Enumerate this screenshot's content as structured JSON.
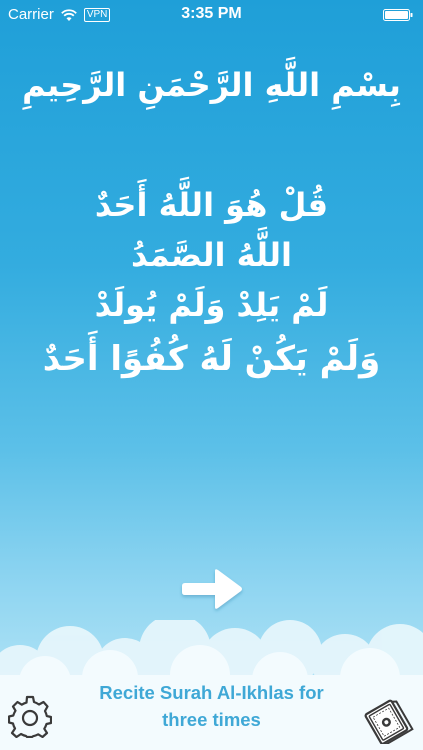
{
  "status_bar": {
    "carrier": "Carrier",
    "vpn": "VPN",
    "time": "3:35 PM"
  },
  "bismillah": "بِسْمِ اللَّهِ الرَّحْمَنِ الرَّحِيمِ",
  "surah": {
    "ayat": [
      "قُلْ هُوَ اللَّهُ أَحَدٌ",
      "اللَّهُ الصَّمَدُ",
      "لَمْ يَلِدْ وَلَمْ يُولَدْ",
      "وَلَمْ يَكُنْ لَهُ كُفُوًا أَحَدٌ"
    ]
  },
  "footer": {
    "instruction_line1": "Recite Surah Al-Ikhlas for",
    "instruction_line2": "three times"
  },
  "icons": {
    "next": "arrow-right-icon",
    "settings": "gear-icon",
    "quran": "book-icon"
  },
  "colors": {
    "sky_top": "#1f9fd8",
    "sky_bottom": "#c5ebf8",
    "instruction_text": "#3fa8d6"
  }
}
